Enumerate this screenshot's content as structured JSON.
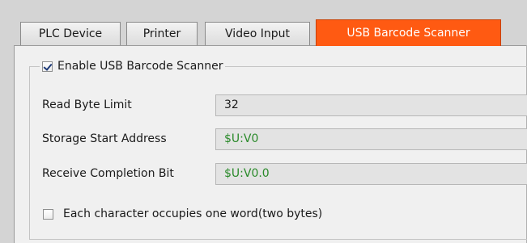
{
  "tabs": [
    {
      "label": "PLC Device",
      "active": false
    },
    {
      "label": "Printer",
      "active": false
    },
    {
      "label": "Video Input",
      "active": false
    },
    {
      "label": "USB Barcode Scanner",
      "active": true
    }
  ],
  "group": {
    "enable_label": "Enable USB Barcode Scanner",
    "enable_checked": true
  },
  "fields": [
    {
      "label": "Read Byte Limit",
      "value": "32",
      "value_color": "#1a1a1a"
    },
    {
      "label": "Storage Start Address",
      "value": "$U:V0",
      "value_color": "#2a8a2a"
    },
    {
      "label": "Receive Completion Bit",
      "value": "$U:V0.0",
      "value_color": "#2a8a2a"
    }
  ],
  "word_option": {
    "label": "Each character occupies one word(two bytes)",
    "checked": false
  },
  "colors": {
    "active_tab": "#ff5a12",
    "address_text": "#2a8a2a"
  }
}
